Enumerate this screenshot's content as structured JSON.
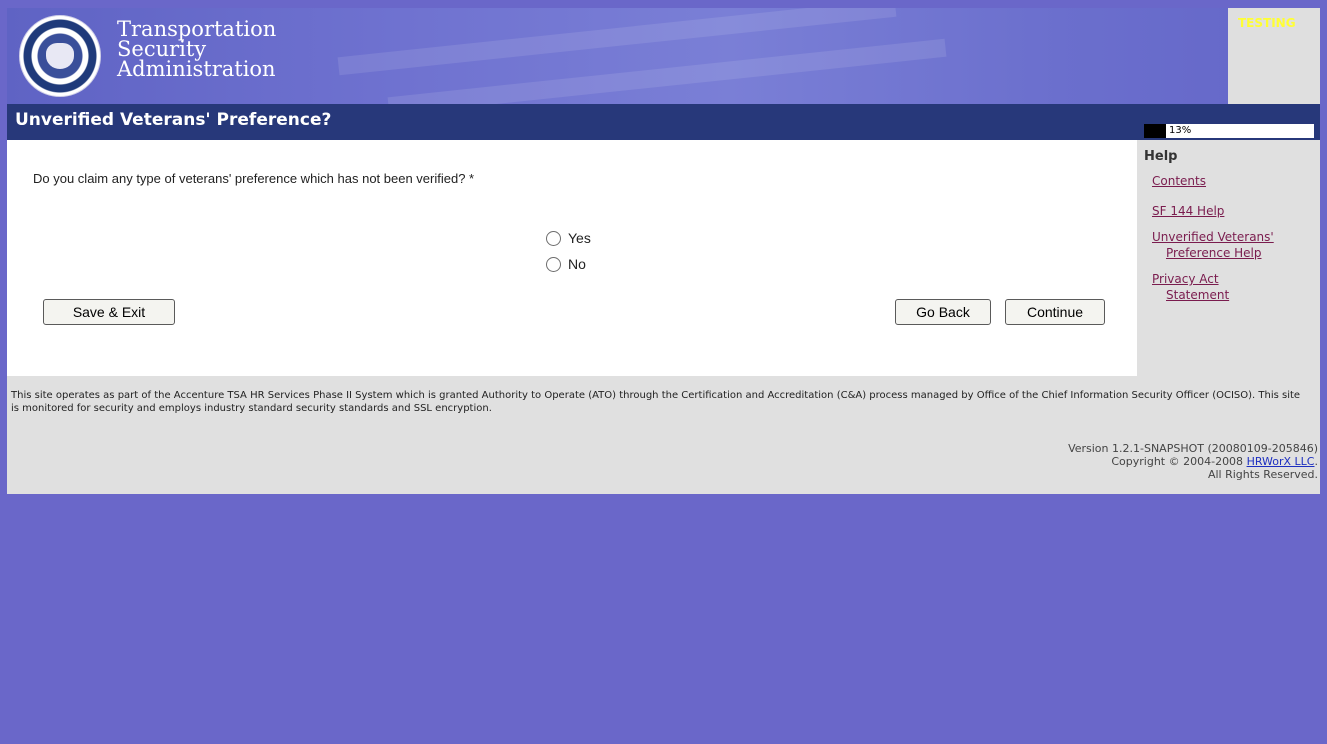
{
  "header": {
    "org_line1": "Transportation",
    "org_line2": "Security",
    "org_line3": "Administration",
    "testing_label": "TESTING"
  },
  "titlebar": {
    "title": "Unverified Veterans' Preference?",
    "progress_text": "13%",
    "progress_value": 0.13
  },
  "main": {
    "question": "Do you claim any type of veterans' preference which has not been verified? *",
    "options": [
      {
        "label": "Yes",
        "selected": false
      },
      {
        "label": "No",
        "selected": false
      }
    ],
    "save_exit_label": "Save & Exit",
    "go_back_label": "Go Back",
    "continue_label": "Continue"
  },
  "help": {
    "title": "Help",
    "links": {
      "contents": "Contents",
      "sf144": "SF 144 Help",
      "uvp_line1": "Unverified Veterans'",
      "uvp_line2": "Preference Help",
      "privacy_line1": "Privacy Act",
      "privacy_line2": "Statement"
    }
  },
  "footer": {
    "note": "This site operates as part of the Accenture TSA HR Services Phase II System which is granted Authority to Operate (ATO) through the Certification and Accreditation (C&A) process managed by Office of the Chief Information Security Officer (OCISO). This site is monitored for security and employs industry standard security standards and SSL encryption.",
    "version": "Version 1.2.1-SNAPSHOT (20080109-205846)",
    "copyright_prefix": "Copyright © 2004-2008 ",
    "copyright_link": "HRWorX LLC",
    "copyright_suffix": ".",
    "rights": "All Rights Reserved."
  },
  "colors": {
    "page_bg": "#6a67c9",
    "titlebar_bg": "#27387a",
    "help_link": "#7a1c4e",
    "testing_text": "#ffff33"
  },
  "icons": {
    "logo": "dhs-seal-icon",
    "radio": "radio-empty-icon"
  }
}
